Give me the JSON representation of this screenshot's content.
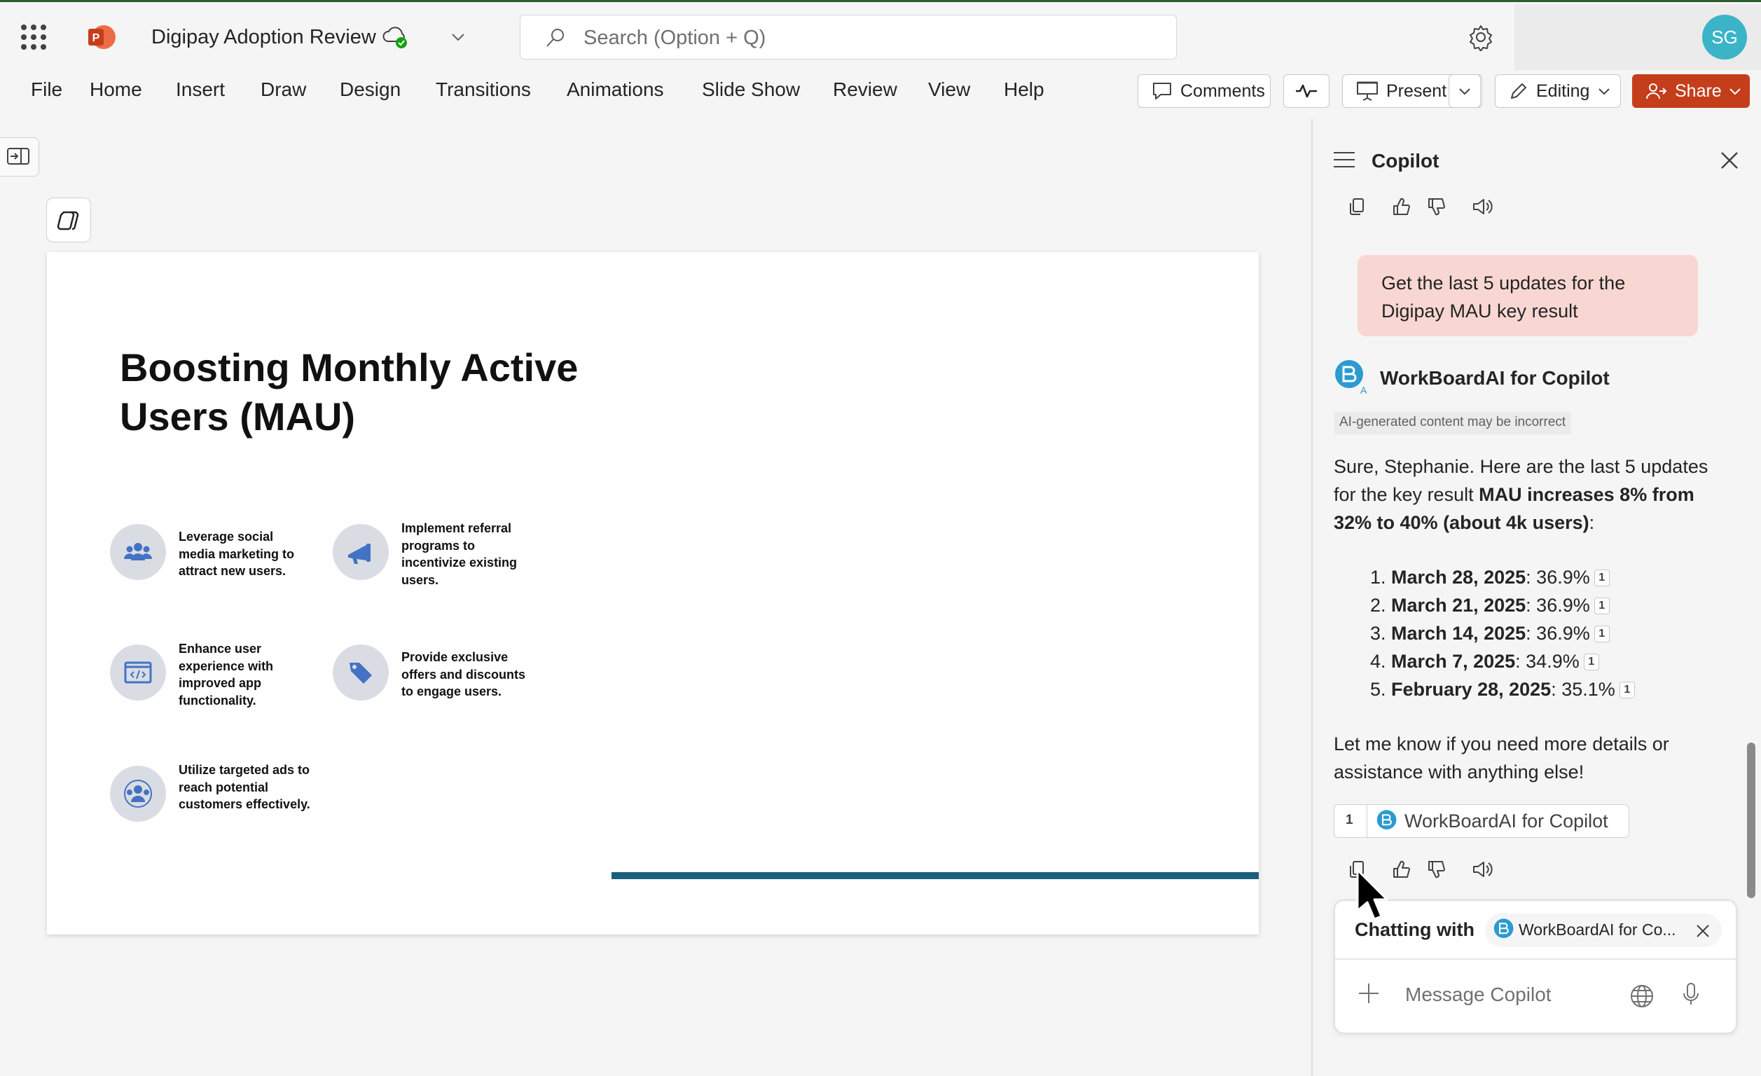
{
  "titlebar": {
    "doc_title": "Digipay Adoption Review",
    "search_placeholder": "Search (Option + Q)",
    "avatar_initials": "SG"
  },
  "ribbon": {
    "menus": [
      "File",
      "Home",
      "Insert",
      "Draw",
      "Design",
      "Transitions",
      "Animations",
      "Slide Show",
      "Review",
      "View",
      "Help"
    ],
    "comments_label": "Comments",
    "present_label": "Present",
    "editing_label": "Editing",
    "share_label": "Share"
  },
  "slide": {
    "title": "Boosting Monthly Active Users (MAU)",
    "items": [
      {
        "text": "Leverage social media marketing to attract new users.",
        "icon": "people-group-icon"
      },
      {
        "text": "Implement referral programs to incentivize existing users.",
        "icon": "megaphone-icon"
      },
      {
        "text": "Enhance user experience with improved app functionality.",
        "icon": "code-window-icon"
      },
      {
        "text": "Provide exclusive offers and discounts to engage users.",
        "icon": "price-tag-icon"
      },
      {
        "text": "Utilize targeted ads to reach potential customers effectively.",
        "icon": "target-audience-icon"
      }
    ]
  },
  "copilot": {
    "title": "Copilot",
    "user_message": "Get the last 5 updates for the Digipay MAU key result",
    "bot_name": "WorkBoardAI for Copilot",
    "ai_disclaimer": "AI-generated content may be incorrect",
    "response_intro_1": "Sure, Stephanie. Here are the last 5 updates for the key result ",
    "response_intro_bold": "MAU increases 8% from 32% to 40% (about 4k users)",
    "response_intro_2": ":",
    "updates": [
      {
        "num": "1.",
        "date": "March 28, 2025",
        "value": ": 36.9%",
        "cite": "1"
      },
      {
        "num": "2.",
        "date": "March 21, 2025",
        "value": ": 36.9%",
        "cite": "1"
      },
      {
        "num": "3.",
        "date": "March 14, 2025",
        "value": ": 36.9%",
        "cite": "1"
      },
      {
        "num": "4.",
        "date": "March 7, 2025",
        "value": ": 34.9%",
        "cite": "1"
      },
      {
        "num": "5.",
        "date": "February 28, 2025",
        "value": ": 35.1%",
        "cite": "1"
      }
    ],
    "response_outro": "Let me know if you need more details or assistance with anything else!",
    "reference": {
      "num": "1",
      "label": "WorkBoardAI for Copilot"
    },
    "chatting_with": "Chatting with",
    "chip_label": "WorkBoardAI for Co...",
    "message_placeholder": "Message Copilot"
  },
  "colors": {
    "share_button": "#c43e1c",
    "user_bubble": "#f8d7d2",
    "avatar": "#3bb4c8",
    "slide_accent_line": "#1a5f7f",
    "icon_blue": "#4472c4"
  }
}
